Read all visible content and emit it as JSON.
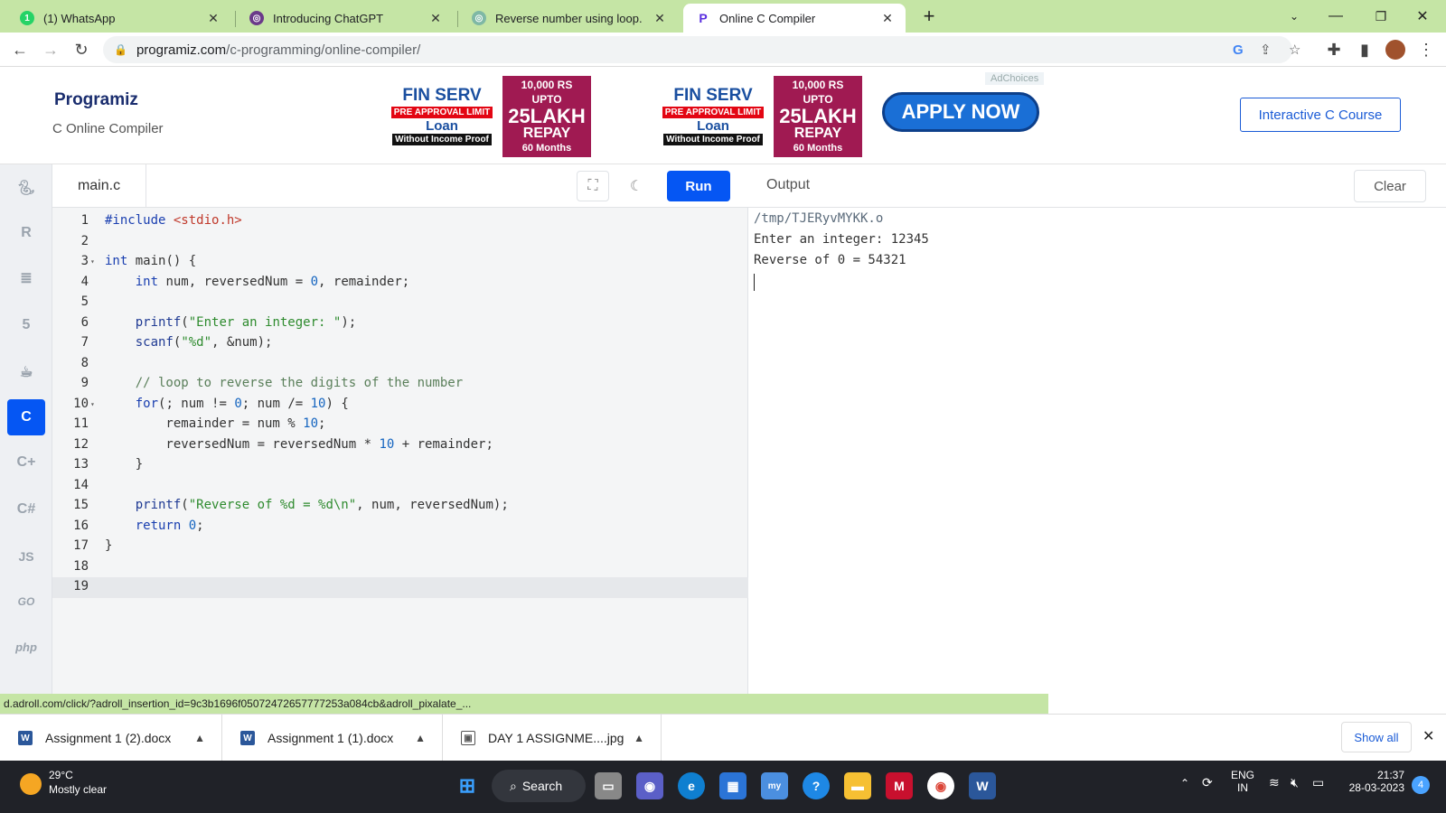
{
  "browser": {
    "tabs": [
      {
        "title": "(1) WhatsApp",
        "icon": "whatsapp-icon"
      },
      {
        "title": "Introducing ChatGPT",
        "icon": "chatgpt-icon"
      },
      {
        "title": "Reverse number using loop.",
        "icon": "chatgpt-icon"
      },
      {
        "title": "Online C Compiler",
        "icon": "programiz-icon",
        "active": true
      }
    ],
    "url_host": "programiz.com",
    "url_path": "/c-programming/online-compiler/"
  },
  "site": {
    "logo": "Programiz",
    "subtitle": "C Online Compiler",
    "course_button": "Interactive C Course",
    "ad": {
      "brand": "FIN SERV",
      "pre_approval": "PRE APPROVAL LIMIT",
      "loan": "Loan",
      "proof": "Without Income Proof",
      "amount_top": "10,000 RS",
      "upto": "UPTO",
      "amount": "25LAKH",
      "repay": "REPAY",
      "months": "60 Months",
      "cta": "APPLY NOW",
      "adchoices": "AdChoices"
    }
  },
  "editor": {
    "filename": "main.c",
    "run_label": "Run",
    "code_lines": [
      "#include <stdio.h>",
      "",
      "int main() {",
      "    int num, reversedNum = 0, remainder;",
      "",
      "    printf(\"Enter an integer: \");",
      "    scanf(\"%d\", &num);",
      "",
      "    // loop to reverse the digits of the number",
      "    for(; num != 0; num /= 10) {",
      "        remainder = num % 10;",
      "        reversedNum = reversedNum * 10 + remainder;",
      "    }",
      "",
      "    printf(\"Reverse of %d = %d\\n\", num, reversedNum);",
      "    return 0;",
      "}",
      "",
      ""
    ],
    "current_line": 19
  },
  "output": {
    "title": "Output",
    "clear_label": "Clear",
    "lines": [
      "/tmp/TJERyvMYKK.o",
      "Enter an integer: 12345",
      "Reverse of 0 = 54321"
    ]
  },
  "rail": [
    "python-icon",
    "r-icon",
    "database-icon",
    "html5-icon",
    "java-icon",
    "c-icon",
    "cpp-icon",
    "csharp-icon",
    "JS",
    "GO",
    "php"
  ],
  "status_url": "d.adroll.com/click/?adroll_insertion_id=9c3b1696f05072472657777253a084cb&adroll_pixalate_...",
  "downloads": {
    "items": [
      "Assignment 1 (2).docx",
      "Assignment 1 (1).docx",
      "DAY 1 ASSIGNME....jpg"
    ],
    "show_all": "Show all"
  },
  "taskbar": {
    "temp": "29°C",
    "weather": "Mostly clear",
    "search": "Search",
    "lang1": "ENG",
    "lang2": "IN",
    "time": "21:37",
    "date": "28-03-2023",
    "notif_count": "4"
  }
}
